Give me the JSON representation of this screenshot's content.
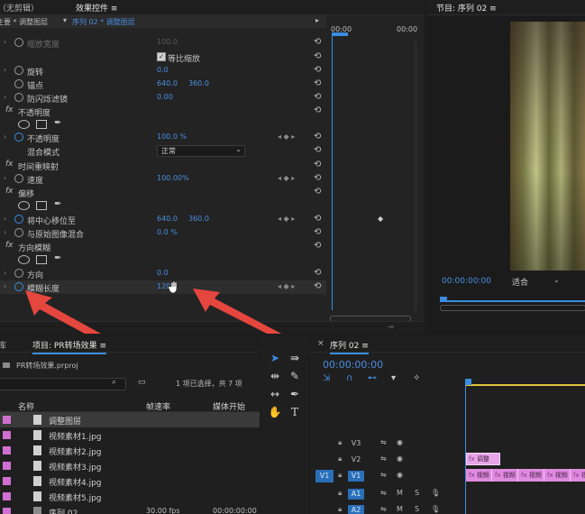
{
  "effect_controls": {
    "tab_no_clip": "（无剪辑）",
    "tab_effect_controls": "效果控件",
    "tab_menu": "≡",
    "breadcrumb_source": "主要 * 调整图层",
    "breadcrumb_sequence": "序列 02 * 调整图层",
    "ruler_start": "00:00",
    "ruler_end": "00:00",
    "rows": [
      {
        "label": "缩放宽度",
        "value": "100.0"
      },
      {
        "label": "等比缩放",
        "checkbox": true
      },
      {
        "label": "旋转",
        "value": "0.0"
      },
      {
        "label": "锚点",
        "value": "640.0",
        "value2": "360.0"
      },
      {
        "label": "防闪烁滤镜",
        "value": "0.00"
      },
      {
        "label": "不透明度",
        "fx": "fx"
      },
      {
        "label": "不透明度",
        "value": "100.0 %"
      },
      {
        "label": "混合模式",
        "value": "正常"
      },
      {
        "label": "时间重映射",
        "fx": "fx"
      },
      {
        "label": "速度",
        "value": "100.00%"
      },
      {
        "label": "偏移",
        "fx": "fx"
      },
      {
        "label": "将中心移位至",
        "value": "640.0",
        "value2": "360.0"
      },
      {
        "label": "与原始图像混合",
        "value": "0.0 %"
      },
      {
        "label": "方向模糊",
        "fx": "fx"
      },
      {
        "label": "方向",
        "value": "0.0"
      },
      {
        "label": "模糊长度",
        "value": "120"
      }
    ]
  },
  "program_monitor": {
    "title": "节目: 序列 02",
    "menu": "≡",
    "timecode": "00:00:00:00",
    "fit": "适合"
  },
  "project": {
    "tab_prev": "库",
    "tab_project": "项目: PR转场效果",
    "menu": "≡",
    "file_name": "PR转场效果.prproj",
    "search_placeholder": "",
    "selection_info": "1 项已选择，共 7 项",
    "col_name": "名称",
    "col_fps": "帧速率",
    "col_start": "媒体开始",
    "items": [
      {
        "name": "调整图层",
        "fps": "",
        "start": ""
      },
      {
        "name": "视频素材1.jpg",
        "fps": "",
        "start": ""
      },
      {
        "name": "视频素材2.jpg",
        "fps": "",
        "start": ""
      },
      {
        "name": "视频素材3.jpg",
        "fps": "",
        "start": ""
      },
      {
        "name": "视频素材4.jpg",
        "fps": "",
        "start": ""
      },
      {
        "name": "视频素材5.jpg",
        "fps": "",
        "start": ""
      },
      {
        "name": "序列 02",
        "fps": "30.00 fps",
        "start": "00:00:00:00"
      }
    ]
  },
  "timeline": {
    "close": "×",
    "title": "序列 02",
    "menu": "≡",
    "timecode": "00:00:00:00",
    "tracks": [
      {
        "name": "V3",
        "src": ""
      },
      {
        "name": "V2",
        "src": ""
      },
      {
        "name": "V1",
        "src": "V1"
      },
      {
        "name": "A1",
        "src": ""
      },
      {
        "name": "A2",
        "src": ""
      }
    ],
    "adjustment_clip": "调整",
    "clips": [
      "视频",
      "视频",
      "视频",
      "视频",
      "视频"
    ],
    "audio_m": "M",
    "audio_s": "S"
  },
  "colors": {
    "accent_blue": "#3a8de0",
    "label_pink": "#d06fd0",
    "arrow_red": "#e5463e"
  }
}
